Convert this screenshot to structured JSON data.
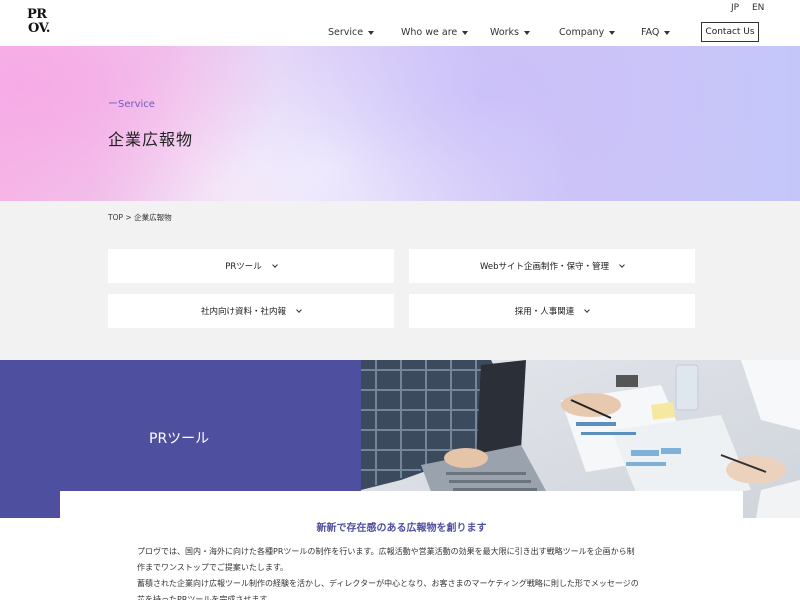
{
  "header": {
    "logo_line1": "PR",
    "logo_line2": "OV.",
    "lang_jp": "JP",
    "lang_en": "EN",
    "nav": [
      {
        "label": "Service"
      },
      {
        "label": "Who we are"
      },
      {
        "label": "Works"
      },
      {
        "label": "Company"
      },
      {
        "label": "FAQ"
      }
    ],
    "contact_label": "Contact Us"
  },
  "hero": {
    "subtitle": "ーService",
    "title": "企業広報物"
  },
  "breadcrumb": {
    "home": "TOP",
    "separator": ">",
    "current": "企業広報物"
  },
  "categories": [
    {
      "label": "PRツール"
    },
    {
      "label": "Webサイト企画制作・保守・管理"
    },
    {
      "label": "社内向け資料・社内報"
    },
    {
      "label": "採用・人事関連"
    }
  ],
  "pr_section": {
    "title": "PRツール",
    "heading": "新新で存在感のある広報物を創ります",
    "paragraph1_line1": "プロヴでは、国内・海外に向けた各種PRツールの制作を行います。広報活動や営業活動の効果を最大限に引き出す戦略ツールを企画から制",
    "paragraph1_line2": "作までワンストップでご提案いたします。",
    "paragraph2_line1": "蓄積された企業向け広報ツール制作の経験を活かし、ディレクターが中心となり、お客さまのマーケティング戦略に則した形でメッセージの",
    "paragraph2_line2": "芯を持ったPRツールを完成させます。"
  },
  "colors": {
    "accent": "#4f4f9f",
    "hero_subtitle": "#6d5bc2",
    "gray_bg": "#f2f2f2"
  }
}
